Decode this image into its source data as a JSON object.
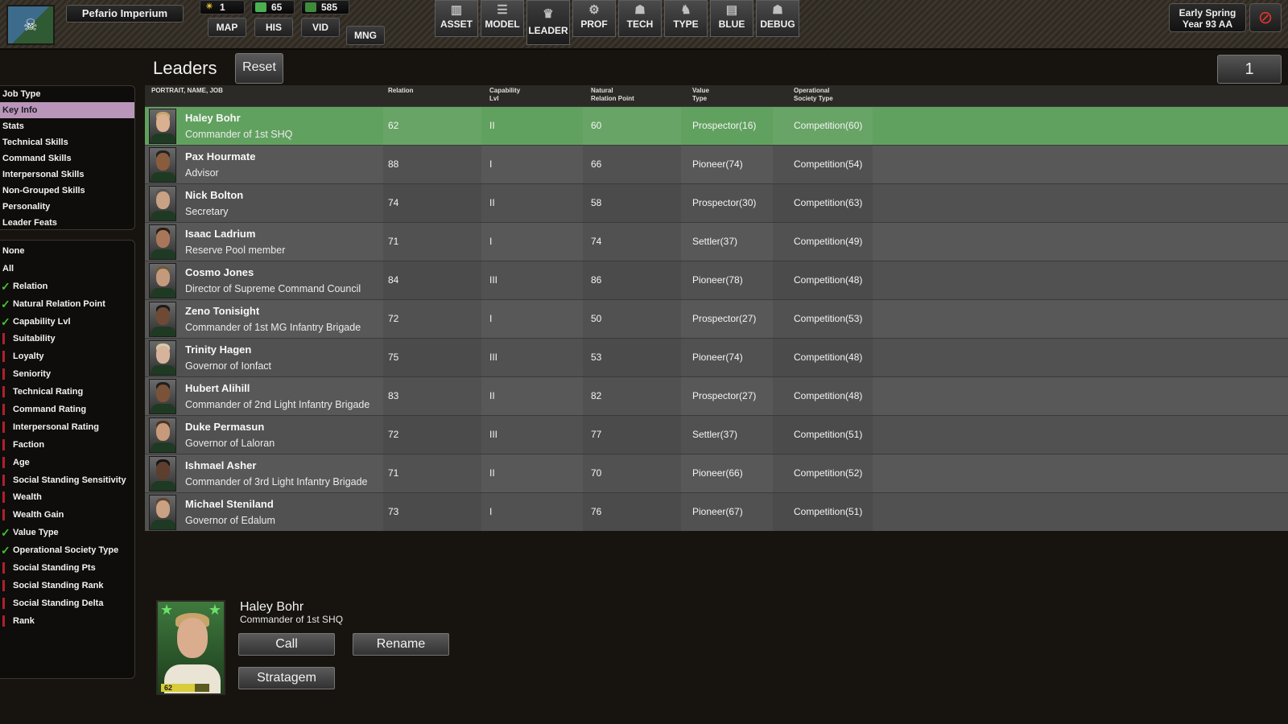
{
  "top": {
    "empire_name": "Pefario Imperium",
    "flag_icon": "skull-emblem-icon",
    "resources": [
      {
        "icon": "sun-icon",
        "value": "1",
        "color": "#e6c23a"
      },
      {
        "icon": "green-gem-icon",
        "value": "65",
        "color": "#4bb04f"
      },
      {
        "icon": "cash-icon",
        "value": "585",
        "color": "#3f8a3b"
      }
    ],
    "nav_tabs": [
      "MAP",
      "HIS",
      "VID",
      "MNG"
    ],
    "main_tabs": [
      {
        "label": "ASSET",
        "icon": "buildings-icon",
        "glyph": "▥"
      },
      {
        "label": "MODEL",
        "icon": "sliders-icon",
        "glyph": "☰"
      },
      {
        "label": "LEADER",
        "icon": "eagle-icon",
        "glyph": "♛"
      },
      {
        "label": "PROF",
        "icon": "gears-icon",
        "glyph": "⚙"
      },
      {
        "label": "TECH",
        "icon": "hierarchy-icon",
        "glyph": "☗"
      },
      {
        "label": "TYPE",
        "icon": "soldier-icon",
        "glyph": "♞"
      },
      {
        "label": "BLUE",
        "icon": "document-icon",
        "glyph": "▤"
      },
      {
        "label": "DEBUG",
        "icon": "network-icon",
        "glyph": "☗"
      }
    ],
    "active_tab": "LEADER",
    "date_line1": "Early Spring",
    "date_line2": "Year 93 AA",
    "stop_glyph": "⊘"
  },
  "header": {
    "title": "Leaders",
    "reset_label": "Reset",
    "page_number": "1"
  },
  "sidebar": {
    "categories": [
      "Job Type",
      "Key Info",
      "Stats",
      "Technical Skills",
      "Command Skills",
      "Interpersonal Skills",
      "Non-Grouped Skills",
      "Personality",
      "Leader Feats"
    ],
    "active_category": "Key Info",
    "filter_none": "None",
    "filter_all": "All",
    "columns": [
      {
        "label": "Relation",
        "on": true
      },
      {
        "label": "Natural Relation Point",
        "on": true
      },
      {
        "label": "Capability Lvl",
        "on": true
      },
      {
        "label": "Suitability",
        "on": false
      },
      {
        "label": "Loyalty",
        "on": false
      },
      {
        "label": "Seniority",
        "on": false
      },
      {
        "label": "Technical Rating",
        "on": false
      },
      {
        "label": "Command Rating",
        "on": false
      },
      {
        "label": "Interpersonal Rating",
        "on": false
      },
      {
        "label": "Faction",
        "on": false
      },
      {
        "label": "Age",
        "on": false
      },
      {
        "label": "Social Standing Sensitivity",
        "on": false
      },
      {
        "label": "Wealth",
        "on": false
      },
      {
        "label": "Wealth Gain",
        "on": false
      },
      {
        "label": "Value Type",
        "on": true
      },
      {
        "label": "Operational Society Type",
        "on": true
      },
      {
        "label": "Social Standing Pts",
        "on": false
      },
      {
        "label": "Social Standing Rank",
        "on": false
      },
      {
        "label": "Social Standing Delta",
        "on": false
      },
      {
        "label": "Rank",
        "on": false
      }
    ]
  },
  "table": {
    "headers": {
      "portrait": "PORTRAIT, NAME, JOB",
      "relation": "Relation",
      "capability_1": "Capability",
      "capability_2": "Lvl",
      "natural_1": "Natural",
      "natural_2": "Relation Point",
      "value_1": "Value",
      "value_2": "Type",
      "op_1": "Operational",
      "op_2": "Society Type"
    },
    "selected_index": 0,
    "rows": [
      {
        "name": "Haley Bohr",
        "job": "Commander of 1st SHQ",
        "relation": "62",
        "capability": "II",
        "natural": "60",
        "value_type": "Prospector(16)",
        "op_type": "Competition(60)",
        "skin": "#d9b090",
        "hair": "#c8a46a"
      },
      {
        "name": "Pax Hourmate",
        "job": "Advisor",
        "relation": "88",
        "capability": "I",
        "natural": "66",
        "value_type": "Pioneer(74)",
        "op_type": "Competition(54)",
        "skin": "#8a5c3e",
        "hair": "#222"
      },
      {
        "name": "Nick Bolton",
        "job": "Secretary",
        "relation": "74",
        "capability": "II",
        "natural": "58",
        "value_type": "Prospector(30)",
        "op_type": "Competition(63)",
        "skin": "#c9a185",
        "hair": "#555"
      },
      {
        "name": "Isaac Ladrium",
        "job": "Reserve Pool member",
        "relation": "71",
        "capability": "I",
        "natural": "74",
        "value_type": "Settler(37)",
        "op_type": "Competition(49)",
        "skin": "#a8775a",
        "hair": "#2a1d14"
      },
      {
        "name": "Cosmo Jones",
        "job": "Director of Supreme Command Council",
        "relation": "84",
        "capability": "III",
        "natural": "86",
        "value_type": "Pioneer(78)",
        "op_type": "Competition(48)",
        "skin": "#c49a7c",
        "hair": "#6b5a3a"
      },
      {
        "name": "Zeno Tonisight",
        "job": "Commander of 1st MG Infantry Brigade",
        "relation": "72",
        "capability": "I",
        "natural": "50",
        "value_type": "Prospector(27)",
        "op_type": "Competition(53)",
        "skin": "#6e4a34",
        "hair": "#1a1a1a"
      },
      {
        "name": "Trinity Hagen",
        "job": "Governor of Ionfact",
        "relation": "75",
        "capability": "III",
        "natural": "53",
        "value_type": "Pioneer(74)",
        "op_type": "Competition(48)",
        "skin": "#d6b49c",
        "hair": "#d8c9a8"
      },
      {
        "name": "Hubert Alihill",
        "job": "Commander of 2nd Light Infantry Brigade",
        "relation": "83",
        "capability": "II",
        "natural": "82",
        "value_type": "Prospector(27)",
        "op_type": "Competition(48)",
        "skin": "#7a5238",
        "hair": "#1e1e1e"
      },
      {
        "name": "Duke Permasun",
        "job": "Governor of Laloran",
        "relation": "72",
        "capability": "III",
        "natural": "77",
        "value_type": "Settler(37)",
        "op_type": "Competition(51)",
        "skin": "#c69a7a",
        "hair": "#4a3422"
      },
      {
        "name": "Ishmael Asher",
        "job": "Commander of 3rd Light Infantry Brigade",
        "relation": "71",
        "capability": "II",
        "natural": "70",
        "value_type": "Pioneer(66)",
        "op_type": "Competition(52)",
        "skin": "#5e3e2c",
        "hair": "#151515"
      },
      {
        "name": "Michael Steniland",
        "job": "Governor of Edalum",
        "relation": "73",
        "capability": "I",
        "natural": "76",
        "value_type": "Pioneer(67)",
        "op_type": "Competition(51)",
        "skin": "#caa183",
        "hair": "#5d4630"
      }
    ]
  },
  "detail": {
    "name": "Haley Bohr",
    "job": "Commander of 1st SHQ",
    "level": "62",
    "star_glyph": "★",
    "call_label": "Call",
    "rename_label": "Rename",
    "stratagem_label": "Stratagem"
  }
}
